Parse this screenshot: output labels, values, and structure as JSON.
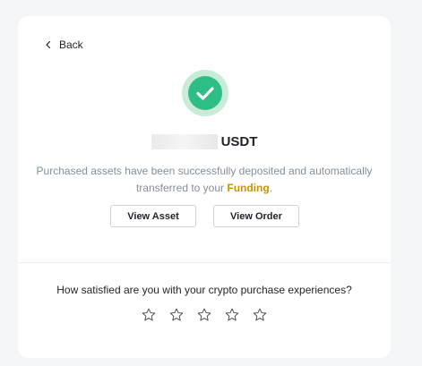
{
  "header": {
    "back_label": "Back",
    "back_icon": "chevron-left-icon"
  },
  "result": {
    "status_icon": "check-circle-icon",
    "amount_hidden": true,
    "currency": "USDT",
    "message_prefix": "Purchased assets have been successfully deposited and automatically transferred to your ",
    "message_link": "Funding",
    "message_suffix": "."
  },
  "actions": {
    "view_asset_label": "View Asset",
    "view_order_label": "View Order"
  },
  "feedback": {
    "question": "How satisfied are you with your crypto purchase experiences?",
    "rating_max": 5,
    "rating_value": 0
  },
  "colors": {
    "success_green": "#2ebd85",
    "success_green_light": "#c9ecd9",
    "link_gold": "#c99400",
    "text_primary": "#1e2329",
    "text_secondary": "#848e9c",
    "page_background": "#f4f5f7",
    "card_background": "#ffffff"
  }
}
